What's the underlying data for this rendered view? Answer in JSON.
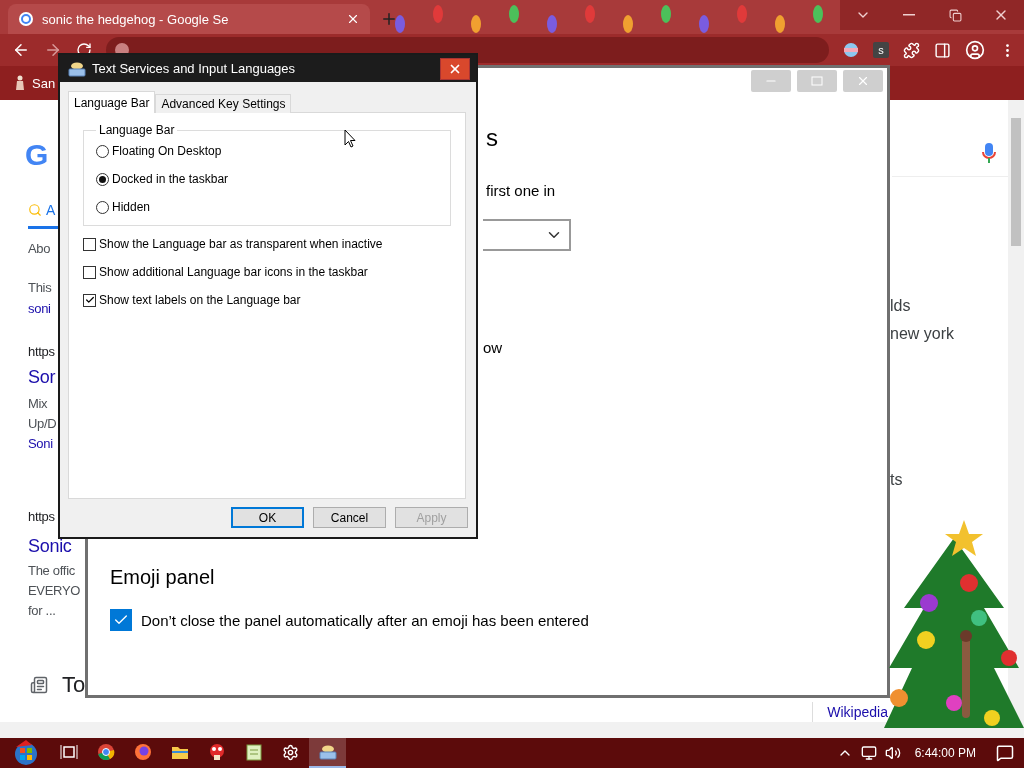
{
  "browser": {
    "tab_title": "sonic the hedgehog - Google Se",
    "extension_letter": "s",
    "bookmarks": [
      "San"
    ],
    "page": {
      "logo": "G",
      "search_tab": "A",
      "left_fragments": [
        {
          "text": "Abo",
          "kind": "meta"
        },
        {
          "text": "This",
          "kind": "meta"
        },
        {
          "text": "soni",
          "kind": "link"
        },
        {
          "text": "https",
          "kind": "url"
        },
        {
          "text": "Sor",
          "kind": "title"
        },
        {
          "text": "Mix",
          "kind": "snippet"
        },
        {
          "text": "Up/D",
          "kind": "snippet"
        },
        {
          "text": "Soni",
          "kind": "link"
        },
        {
          "text": "https",
          "kind": "url"
        },
        {
          "text": "Sonic",
          "kind": "title"
        },
        {
          "text": "The offic",
          "kind": "snippet"
        },
        {
          "text": "EVERYO",
          "kind": "snippet"
        },
        {
          "text": "for ...",
          "kind": "snippet"
        }
      ],
      "section_title": "To",
      "right_fragments": [
        "lds",
        "new york",
        "ts"
      ],
      "footer_link": "Wikipedia"
    }
  },
  "settings_window": {
    "fragments": [
      {
        "text": "s",
        "kind": "heading"
      },
      {
        "text": "first one in",
        "kind": "text"
      },
      {
        "kind": "dropdown"
      },
      {
        "text": "ow",
        "kind": "text"
      }
    ],
    "section": {
      "heading": "Emoji panel",
      "checkbox": {
        "label": "Don’t close the panel automatically after an emoji has been entered",
        "checked": true
      }
    }
  },
  "dialog": {
    "title": "Text Services and Input Languages",
    "tabs": [
      {
        "label": "Language Bar",
        "selected": true
      },
      {
        "label": "Advanced Key Settings",
        "selected": false
      }
    ],
    "group": {
      "label": "Language Bar",
      "options": [
        {
          "label": "Floating On Desktop",
          "selected": false
        },
        {
          "label": "Docked in the taskbar",
          "selected": true
        },
        {
          "label": "Hidden",
          "selected": false
        }
      ]
    },
    "checkboxes": [
      {
        "label": "Show the Language bar as transparent when inactive",
        "checked": false
      },
      {
        "label": "Show additional Language bar icons in the taskbar",
        "checked": false
      },
      {
        "label": "Show text labels on the Language bar",
        "checked": true
      }
    ],
    "buttons": [
      {
        "label": "OK",
        "default": true,
        "disabled": false
      },
      {
        "label": "Cancel",
        "default": false,
        "disabled": false
      },
      {
        "label": "Apply",
        "default": false,
        "disabled": true
      }
    ]
  },
  "taskbar": {
    "apps": [
      {
        "kind": "taskview",
        "active": false
      },
      {
        "kind": "chrome",
        "active": false
      },
      {
        "kind": "firefox",
        "active": false
      },
      {
        "kind": "folder",
        "active": false
      },
      {
        "kind": "game",
        "active": false
      },
      {
        "kind": "notepad",
        "active": false
      },
      {
        "kind": "settings",
        "active": false
      },
      {
        "kind": "keyboard",
        "active": true
      }
    ],
    "clock": "6:44:00 PM"
  }
}
